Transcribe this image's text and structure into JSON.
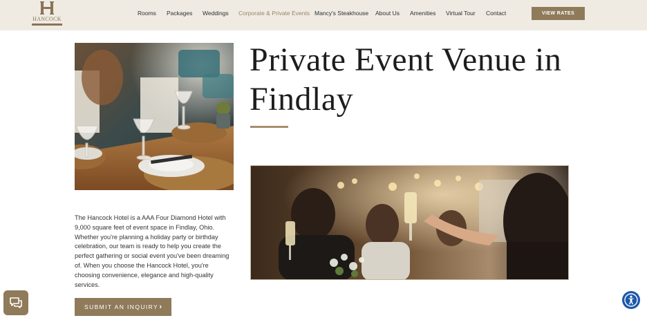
{
  "header": {
    "logo_text": "HANCOCK",
    "nav": [
      {
        "label": "Rooms",
        "active": false
      },
      {
        "label": "Packages",
        "active": false
      },
      {
        "label": "Weddings",
        "active": false
      },
      {
        "label": "Corporate & Private Events",
        "active": true
      },
      {
        "label": "Mancy's Steakhouse",
        "active": false
      },
      {
        "label": "About Us",
        "active": false
      },
      {
        "label": "Amenities",
        "active": false
      },
      {
        "label": "Virtual Tour",
        "active": false
      },
      {
        "label": "Contact",
        "active": false
      }
    ],
    "cta_label": "VIEW RATES"
  },
  "main": {
    "headline_line1": "Private Event Venue in",
    "headline_line2": "Findlay",
    "body": "The Hancock Hotel is a AAA Four Diamond Hotel with 9,000 square feet of event space in Findlay, Ohio. Whether you're planning a holiday party or birthday celebration, our team is ready to help you create the perfect gathering or social event you've been dreaming of. When you choose the Hancock Hotel, you're choosing convenience, elegance and high-quality services.",
    "inquiry_button_label": "SUBMIT AN INQUIRY",
    "inquiry_button_icon": "chevron-right-icon"
  },
  "widgets": {
    "chat_icon": "chat-bubbles-icon",
    "accessibility_icon": "accessibility-icon"
  },
  "colors": {
    "header_bg": "#efebe3",
    "accent": "#8f7a5a",
    "active_nav": "#9a8466",
    "accessibility_blue": "#1b58a8"
  }
}
